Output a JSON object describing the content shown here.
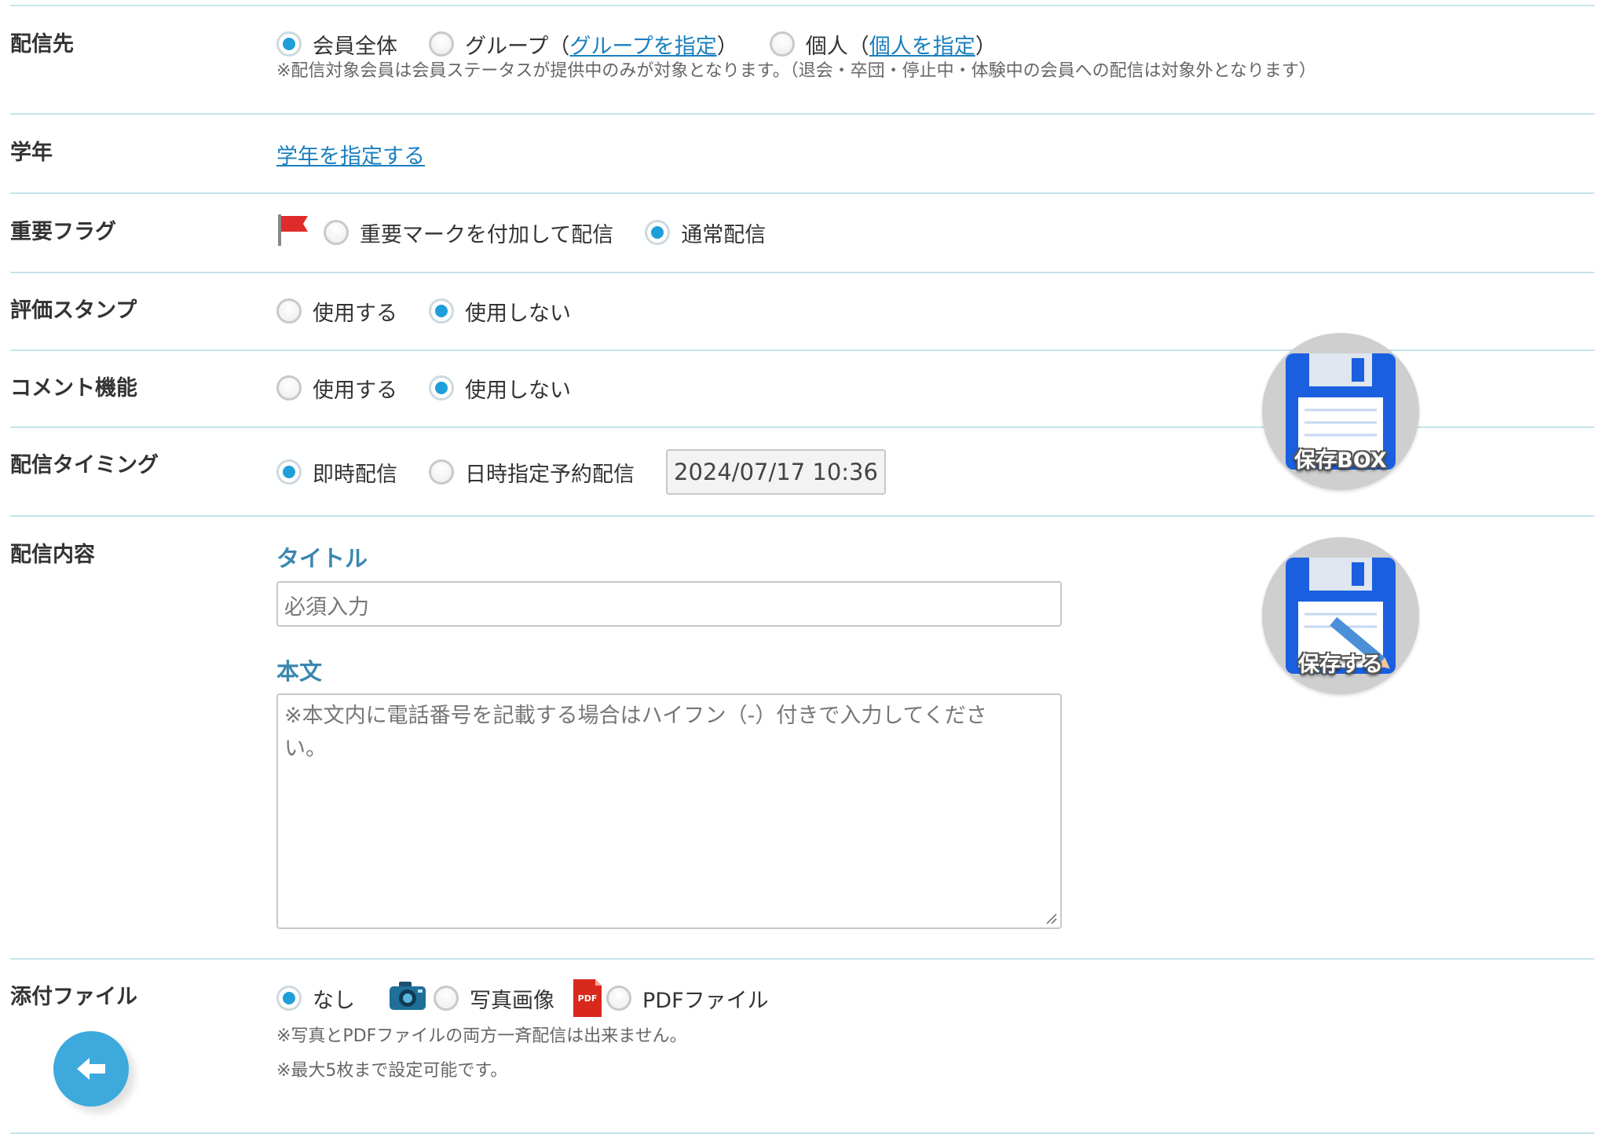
{
  "recipient": {
    "label": "配信先",
    "opt_all": "会員全体",
    "opt_group": "グループ（",
    "group_link": "グループを指定",
    "opt_group_close": "）",
    "opt_person": "個人（",
    "person_link": "個人を指定",
    "opt_person_close": "）",
    "selected": "会員全体",
    "note": "※配信対象会員は会員ステータスが提供中のみが対象となります。（退会・卒団・停止中・体験中の会員への配信は対象外となります）"
  },
  "grade": {
    "label": "学年",
    "link": "学年を指定する"
  },
  "importance": {
    "label": "重要フラグ",
    "opt_important": "重要マークを付加して配信",
    "opt_normal": "通常配信",
    "selected": "通常配信",
    "flag_icon": "red-flag-icon"
  },
  "stamp": {
    "label": "評価スタンプ",
    "opt_use": "使用する",
    "opt_nouse": "使用しない",
    "selected": "使用しない"
  },
  "comment": {
    "label": "コメント機能",
    "opt_use": "使用する",
    "opt_nouse": "使用しない",
    "selected": "使用しない"
  },
  "timing": {
    "label": "配信タイミング",
    "opt_now": "即時配信",
    "opt_schedule": "日時指定予約配信",
    "selected": "即時配信",
    "datetime": "2024/07/17 10:36"
  },
  "content": {
    "label": "配信内容",
    "title_heading": "タイトル",
    "title_placeholder": "必須入力",
    "body_heading": "本文",
    "body_placeholder": "※本文内に電話番号を記載する場合はハイフン（-）付きで入力してください。"
  },
  "attachment": {
    "label": "添付ファイル",
    "opt_none": "なし",
    "opt_photo": "写真画像",
    "opt_pdf": "PDFファイル",
    "selected": "なし",
    "pdf_badge": "PDF",
    "note1": "※写真とPDFファイルの両方一斉配信は出来ません。",
    "note2": "※最大5枚まで設定可能です。"
  },
  "floating": {
    "save_box_label": "保存BOX",
    "save_label": "保存する"
  },
  "colors": {
    "accent": "#1e9fd9",
    "divider": "#c6e3ec",
    "heading": "#3a87b0",
    "link": "#1a7fbf",
    "floppy": "#1a5fe0"
  },
  "icons": {
    "save_box": "floppy-disk-icon",
    "save": "floppy-disk-pencil-icon",
    "back": "back-arrow-icon",
    "camera": "camera-icon",
    "pdf": "pdf-file-icon"
  }
}
